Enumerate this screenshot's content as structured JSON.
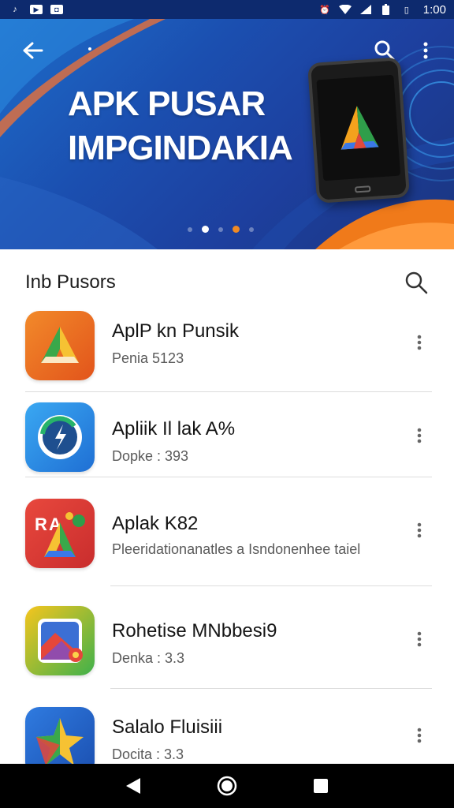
{
  "status_bar": {
    "time": "1:00",
    "icons": [
      "music-note-icon",
      "notification-icon",
      "screen-icon",
      "alarm-icon",
      "wifi-icon",
      "signal-icon",
      "battery-icon"
    ]
  },
  "banner": {
    "title_line1": "APK PUSAR",
    "title_line2": "IMPGINDAKIA",
    "slide_count": 5,
    "active_slide": 1
  },
  "list": {
    "title": "Inb Pusors"
  },
  "apps": [
    {
      "name": "AplP kn Punsik",
      "subtitle": "Penia 5123",
      "icon": "triangle-logo-icon"
    },
    {
      "name": "Apliik Il lak A%",
      "subtitle": "Dopke : 393",
      "icon": "lightning-circle-icon"
    },
    {
      "name": "Aplak K82",
      "subtitle": "Pleeridationanatles a Isndonenhee taiel",
      "icon": "ra-triangle-icon"
    },
    {
      "name": "Rohetise MNbbesi9",
      "subtitle": "Denka : 3.3",
      "icon": "gallery-icon"
    },
    {
      "name": "Salalo Fluisiii",
      "subtitle": "Docita : 3.3",
      "icon": "star-logo-icon"
    }
  ],
  "colors": {
    "status_bar": "#0d2a6e",
    "banner_blue": "#1b4fb0",
    "accent_orange": "#f08a24",
    "nav_bar": "#000000"
  }
}
